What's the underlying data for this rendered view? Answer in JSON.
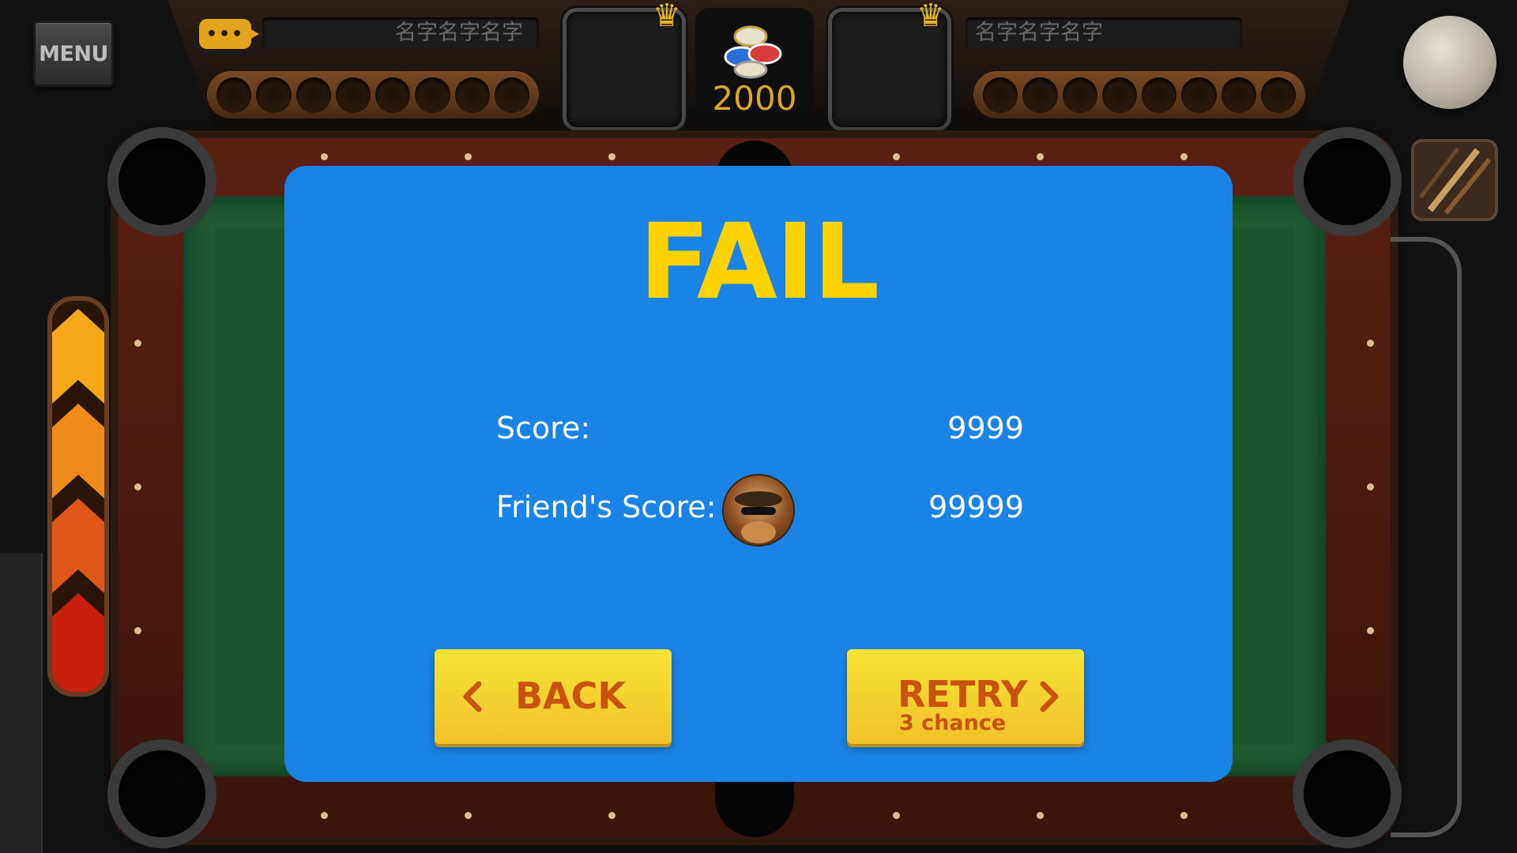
{
  "hud": {
    "menu_label": "MENU",
    "chat_icon": "•••",
    "player_left_name": "名字名字名字",
    "player_right_name": "名字名字名字",
    "pot_coins": "2000"
  },
  "dialog": {
    "title": "FAIL",
    "score_label": "Score:",
    "score_value": "9999",
    "friend_score_label": "Friend's Score:",
    "friend_score_value": "99999",
    "back_label": "BACK",
    "retry_label": "RETRY",
    "retry_sub": "3 chance"
  },
  "colors": {
    "dialog_bg": "#1a84e6",
    "title": "#ffd200",
    "button_bg": "#f5d231",
    "button_text": "#c9520f",
    "felt": "#1f5a32",
    "rail": "#5a2012"
  },
  "icons": [
    "menu-icon",
    "chat-icon",
    "crown-icon",
    "chips-icon",
    "cue-ball-icon",
    "cue-stick-icon",
    "chevron-left-icon",
    "chevron-right-icon"
  ]
}
